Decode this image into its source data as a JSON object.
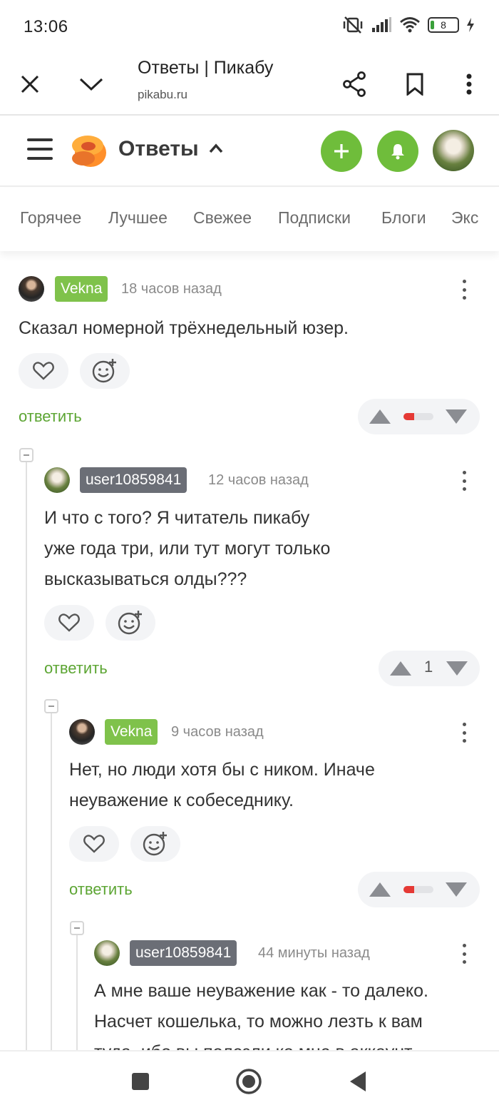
{
  "status": {
    "time": "13:06",
    "battery": "8"
  },
  "browser": {
    "title": "Ответы | Пикабу",
    "url": "pikabu.ru"
  },
  "header": {
    "section": "Ответы"
  },
  "tabs": [
    "Горячее",
    "Лучшее",
    "Свежее",
    "Подписки",
    "Блоги",
    "Экс"
  ],
  "comments": [
    {
      "user": "Vekna",
      "time": "18 часов назад",
      "lines": [
        "Сказал номерной трёхнедельный юзер."
      ],
      "reply": "ответить",
      "rating_fraction": 0.35
    },
    {
      "user": "user10859841",
      "time": "12 часов назад",
      "lines": [
        "И что с того? Я читатель пикабу",
        "уже года три, или тут могут только",
        "высказываться олды???"
      ],
      "reply": "ответить",
      "rating": "1"
    },
    {
      "user": "Vekna",
      "time": "9 часов назад",
      "lines": [
        "Нет, но люди хотя бы с ником. Иначе",
        "неуважение к собеседнику."
      ],
      "reply": "ответить",
      "rating_fraction": 0.35
    },
    {
      "user": "user10859841",
      "time": "44 минуты назад",
      "lines": [
        "А мне ваше неуважение как - то далеко.",
        "Насчет кошелька, то можно лезть к вам",
        "туда, ибо вы полезли ко мне в аккаунт"
      ]
    }
  ],
  "colors": {
    "accent_green": "#6fbd3b",
    "nick_green": "#7fc24b",
    "nick_gray": "#6b6e76",
    "rating_red": "#e53935"
  }
}
